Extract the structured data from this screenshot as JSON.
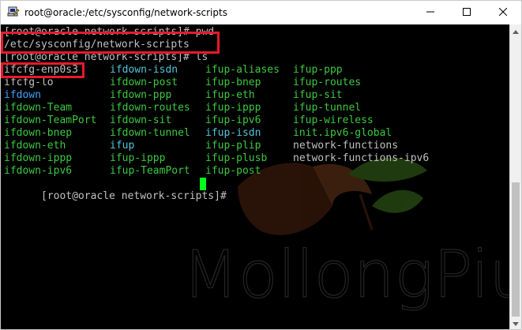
{
  "window": {
    "title": "root@oracle:/etc/sysconfig/network-scripts",
    "app_icon": "putty-icon",
    "minimize_icon": "minimize-icon",
    "maximize_icon": "maximize-icon",
    "close_icon": "close-icon"
  },
  "terminal": {
    "line1": "[root@oracle network-scripts]# pwd",
    "line2": "/etc/sysconfig/network-scripts",
    "line3": "[root@oracle network-scripts]# ls",
    "ls_columns": [
      [
        {
          "text": "ifcfg-enp0s3",
          "color": "white"
        },
        {
          "text": "ifcfg-lo",
          "color": "white"
        },
        {
          "text": "ifdown",
          "color": "blue"
        },
        {
          "text": "ifdown-Team",
          "color": "green"
        },
        {
          "text": "ifdown-TeamPort",
          "color": "green"
        },
        {
          "text": "ifdown-bnep",
          "color": "green"
        },
        {
          "text": "ifdown-eth",
          "color": "green"
        },
        {
          "text": "ifdown-ippp",
          "color": "green"
        },
        {
          "text": "ifdown-ipv6",
          "color": "green"
        }
      ],
      [
        {
          "text": "ifdown-isdn",
          "color": "cyan"
        },
        {
          "text": "ifdown-post",
          "color": "green"
        },
        {
          "text": "ifdown-ppp",
          "color": "green"
        },
        {
          "text": "ifdown-routes",
          "color": "green"
        },
        {
          "text": "ifdown-sit",
          "color": "green"
        },
        {
          "text": "ifdown-tunnel",
          "color": "green"
        },
        {
          "text": "ifup",
          "color": "cyan"
        },
        {
          "text": "ifup-ippp",
          "color": "green"
        },
        {
          "text": "ifup-TeamPort",
          "color": "green"
        }
      ],
      [
        {
          "text": "ifup-aliases",
          "color": "green"
        },
        {
          "text": "ifup-bnep",
          "color": "green"
        },
        {
          "text": "ifup-eth",
          "color": "green"
        },
        {
          "text": "ifup-ippp",
          "color": "green"
        },
        {
          "text": "ifup-ipv6",
          "color": "green"
        },
        {
          "text": "ifup-isdn",
          "color": "cyan"
        },
        {
          "text": "ifup-plip",
          "color": "green"
        },
        {
          "text": "ifup-plusb",
          "color": "green"
        },
        {
          "text": "ifup-post",
          "color": "green"
        }
      ],
      [
        {
          "text": "ifup-ppp",
          "color": "green"
        },
        {
          "text": "ifup-routes",
          "color": "green"
        },
        {
          "text": "ifup-sit",
          "color": "green"
        },
        {
          "text": "ifup-tunnel",
          "color": "green"
        },
        {
          "text": "ifup-wireless",
          "color": "green"
        },
        {
          "text": "init.ipv6-global",
          "color": "green"
        },
        {
          "text": "network-functions",
          "color": "white"
        },
        {
          "text": "network-functions-ipv6",
          "color": "white"
        },
        {
          "text": "",
          "color": "white"
        }
      ]
    ],
    "prompt": "[root@oracle network-scripts]# ",
    "watermark_text": "MollongPiu"
  },
  "colors": {
    "terminal_bg": "#000000",
    "text_default": "#c0c0c0",
    "executable_green": "#3cc840",
    "symlink_cyan": "#52c4d6",
    "directory_blue": "#3ea4ff",
    "cursor": "#00ff1a",
    "highlight_red": "#e8192c"
  }
}
